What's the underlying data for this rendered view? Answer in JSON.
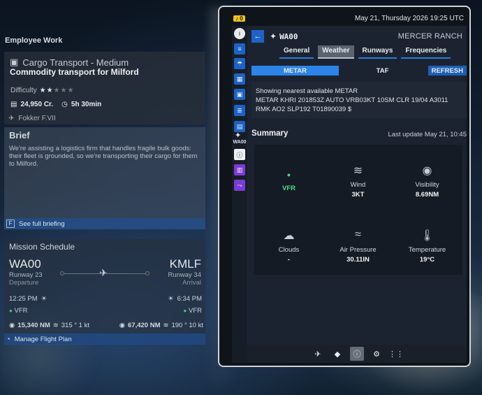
{
  "left": {
    "section_label": "Employee Work",
    "job": {
      "category": "Cargo Transport - Medium",
      "title": "Commodity transport for Milford",
      "difficulty_label": "Difficulty",
      "difficulty_stars": 2,
      "difficulty_max": 5,
      "pay": "24,950 Cr.",
      "duration": "5h 30min",
      "aircraft": "Fokker F.VII"
    },
    "brief": {
      "title": "Brief",
      "text": "We're assisting a logistics firm that handles fragile bulk goods: their fleet is grounded, so we're transporting their cargo for them to Milford.",
      "key": "F",
      "link": "See full briefing"
    },
    "schedule": {
      "title": "Mission Schedule",
      "from": {
        "code": "WA00",
        "runway": "Runway 23",
        "role": "Departure",
        "time": "12:25 PM",
        "cond": "VFR"
      },
      "to": {
        "code": "KMLF",
        "runway": "Runway 34",
        "role": "Arrival",
        "time": "6:34 PM",
        "cond": "VFR"
      },
      "from_vis": "15,340 NM",
      "from_wind": "315 ° 1 kt",
      "to_vis": "67,420 NM",
      "to_wind": "190 ° 10 kt",
      "manage": "Manage Flight Plan"
    }
  },
  "tablet": {
    "alert_count": "0",
    "datetime": "May 21, Thursday 2026 19:25 UTC",
    "airport_code": "WA00",
    "airport_name": "MERCER RANCH",
    "side_badge": "WA00",
    "tabs": [
      "General",
      "Weather",
      "Runways",
      "Frequencies"
    ],
    "active_tab": "Weather",
    "subtabs": {
      "metar": "METAR",
      "taf": "TAF",
      "refresh": "REFRESH"
    },
    "metar_heading": "Showing nearest available METAR",
    "metar_text": "METAR KHRI 201853Z AUTO VRB03KT 10SM CLR 19/04 A3011 RMK AO2 SLP192 T01890039 $",
    "summary_title": "Summary",
    "last_update": "Last update May 21, 10:45",
    "cells": {
      "flight_rules": "VFR",
      "wind_label": "Wind",
      "wind_value": "3KT",
      "visibility_label": "Visibility",
      "visibility_value": "8.69NM",
      "clouds_label": "Clouds",
      "clouds_value": "-",
      "pressure_label": "Air Pressure",
      "pressure_value": "30.11IN",
      "temp_label": "Temperature",
      "temp_value": "19°C"
    }
  },
  "colors": {
    "accent_blue": "#2b84e6",
    "vfr_green": "#4fe08a",
    "purple": "#7b3bd6"
  }
}
